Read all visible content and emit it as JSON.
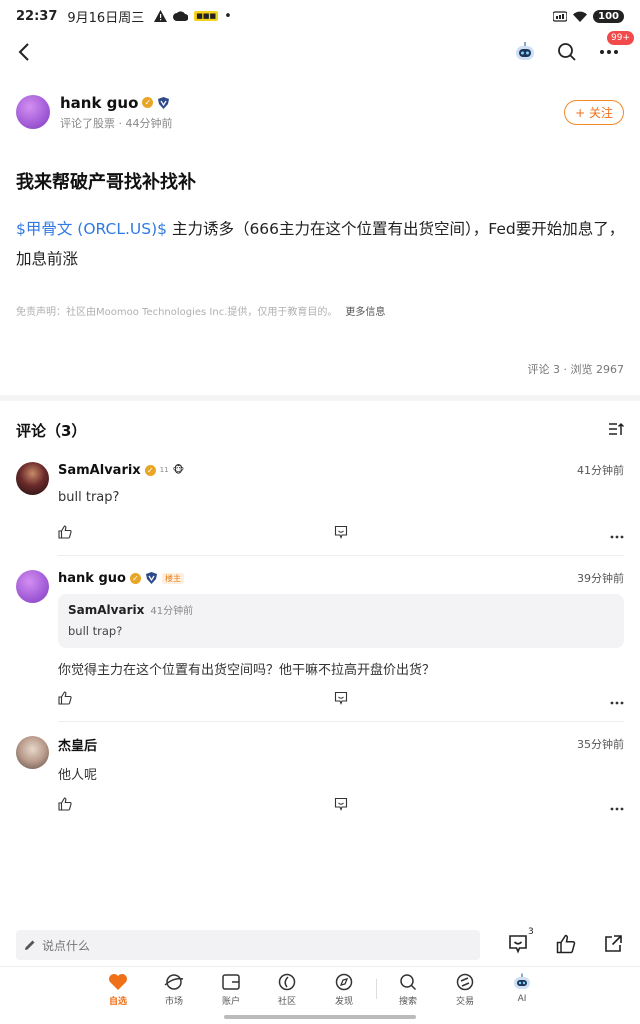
{
  "status_bar": {
    "time": "22:37",
    "date": "9月16日周三",
    "battery": "100"
  },
  "top_nav": {
    "notification_badge": "99+"
  },
  "author": {
    "name": "hank guo",
    "meta": "评论了股票 · 44分钟前",
    "follow_label": "+ 关注"
  },
  "post": {
    "title": "我来帮破产哥找补找补",
    "stock_link": "$甲骨文 (ORCL.US)$",
    "body": " 主力诱多（666主力在这个位置有出货空间），Fed要开始加息了，加息前涨",
    "disclaimer": "免责声明：社区由Moomoo Technologies Inc.提供，仅用于教育目的。",
    "more_info": "更多信息",
    "stats": "评论 3 · 浏览 2967"
  },
  "comments_section": {
    "heading": "评论（3）"
  },
  "comments": [
    {
      "name": "SamAlvarix",
      "level": "11",
      "time": "41分钟前",
      "text": "bull trap?"
    },
    {
      "name": "hank guo",
      "owner_tag": "楼主",
      "time": "39分钟前",
      "quote": {
        "name": "SamAlvarix",
        "time": "41分钟前",
        "text": "bull trap?"
      },
      "text": "你觉得主力在这个位置有出货空间吗？他干嘛不拉高开盘价出货？"
    },
    {
      "name": "杰皇后",
      "time": "35分钟前",
      "text": "他人呢"
    }
  ],
  "input_bar": {
    "placeholder": "说点什么",
    "comment_count": "3"
  },
  "tab_bar": {
    "tabs": [
      {
        "label": "自选",
        "icon": "heart-icon",
        "active": true
      },
      {
        "label": "市场",
        "icon": "planet-icon"
      },
      {
        "label": "账户",
        "icon": "wallet-icon"
      },
      {
        "label": "社区",
        "icon": "community-icon"
      },
      {
        "label": "发现",
        "icon": "compass-icon"
      },
      {
        "label": "搜索",
        "icon": "search-icon"
      },
      {
        "label": "交易",
        "icon": "trade-icon"
      },
      {
        "label": "AI",
        "icon": "robot-icon"
      }
    ]
  },
  "colors": {
    "accent": "#f0701a",
    "link": "#2f7ae5",
    "badge": "#f24a4a"
  }
}
